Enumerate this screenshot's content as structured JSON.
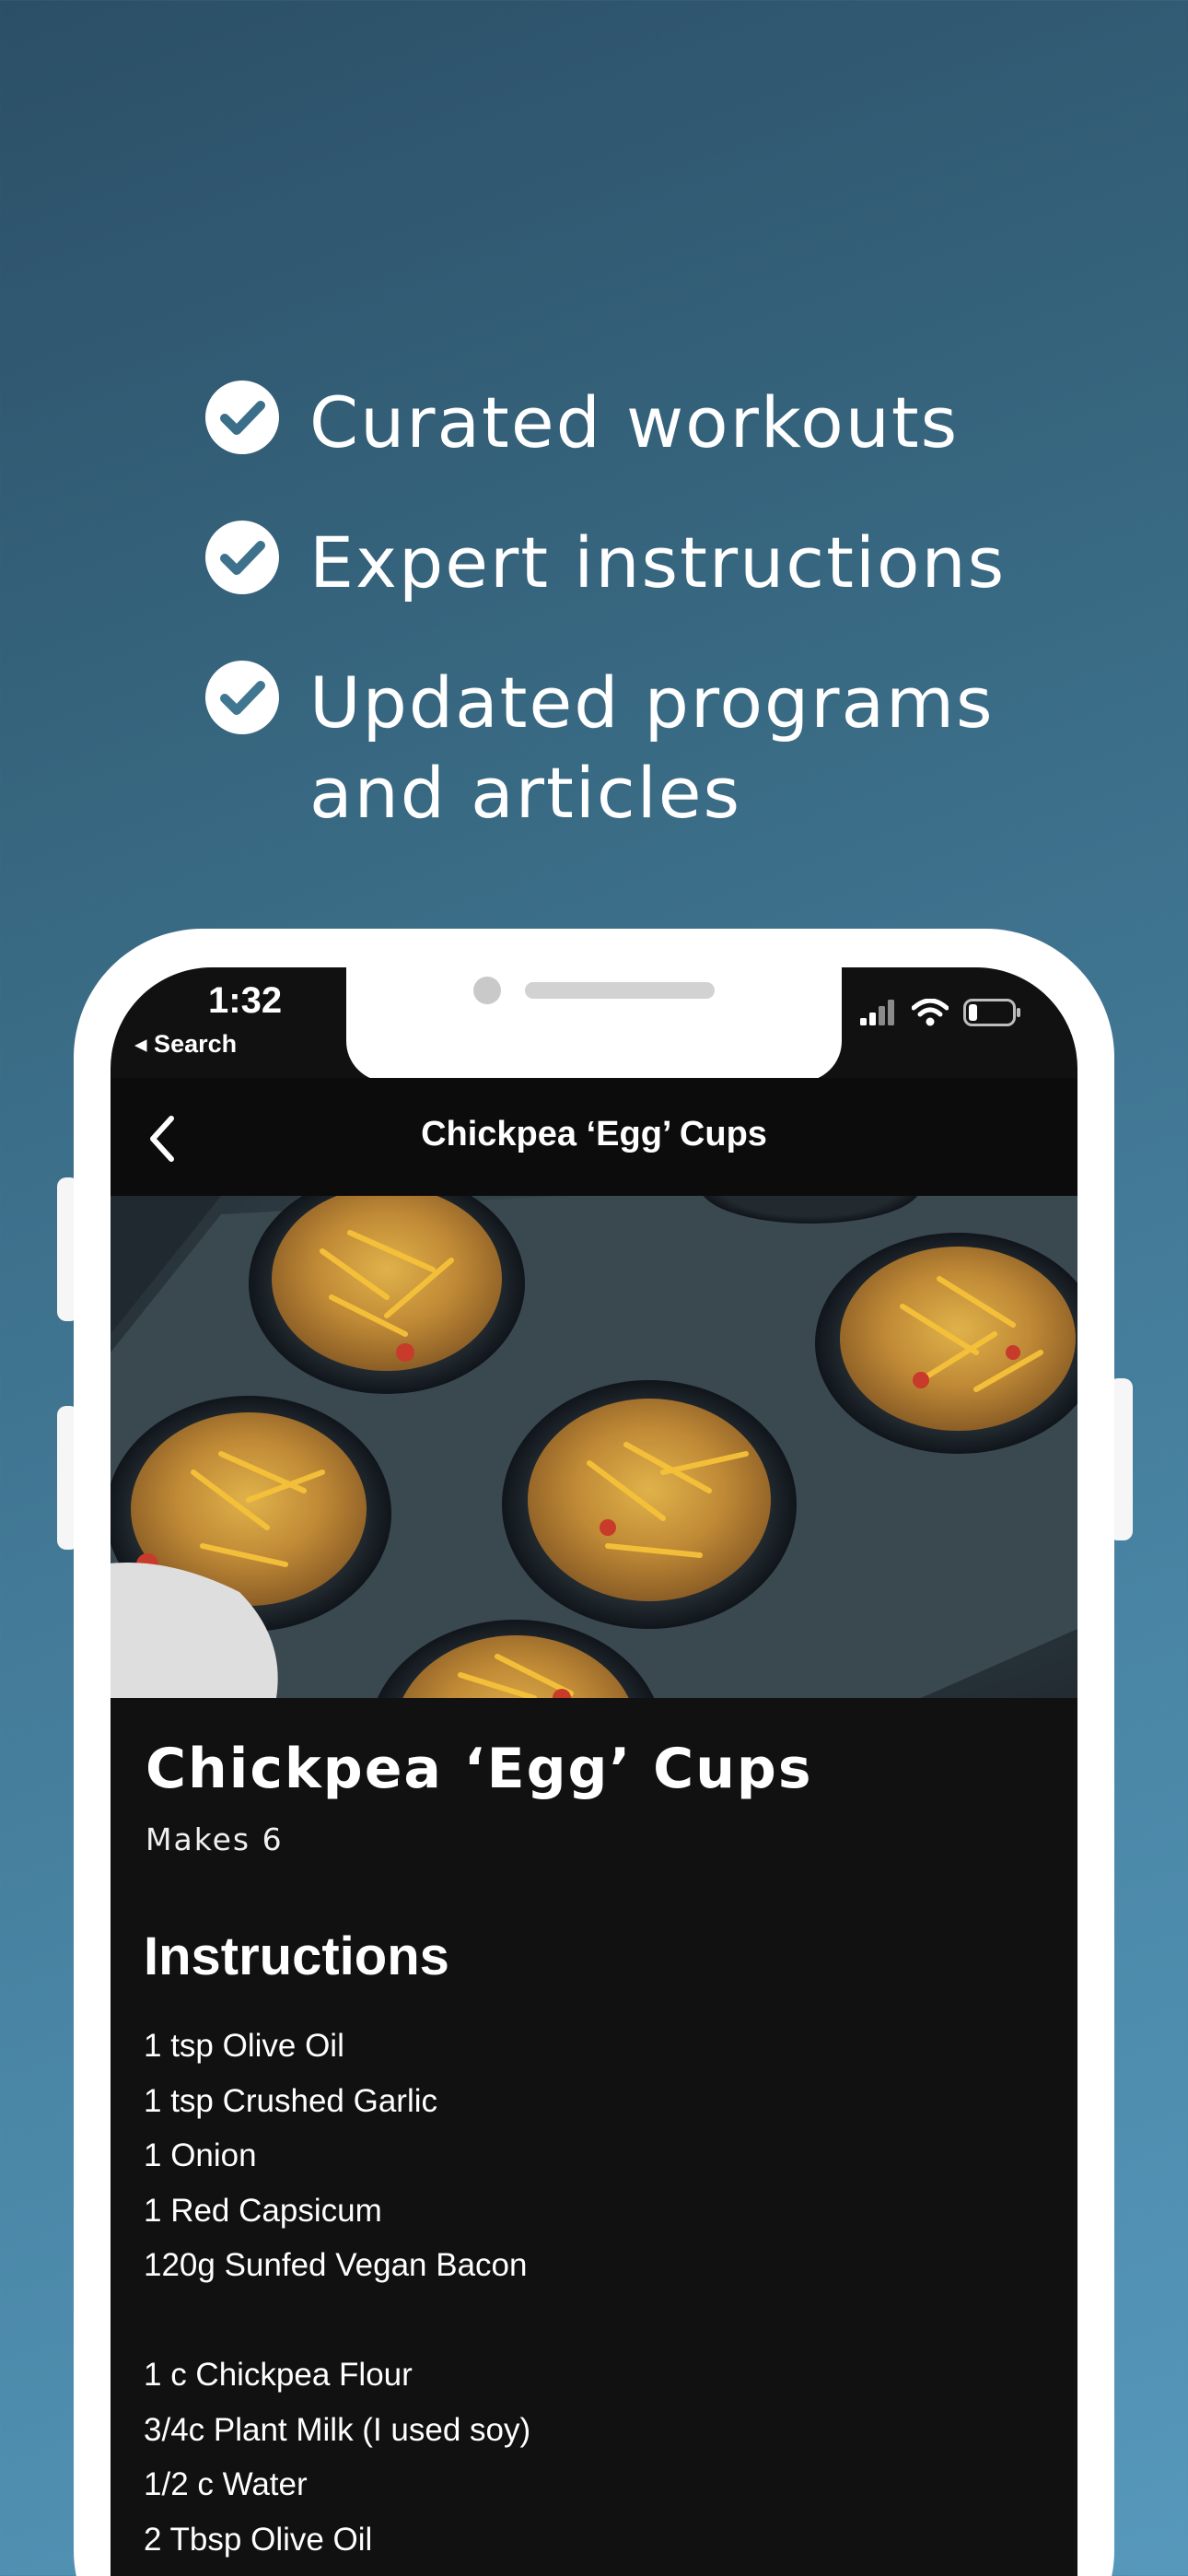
{
  "features": [
    {
      "text": "Curated workouts",
      "icon": "check-circle-icon"
    },
    {
      "text": "Expert instructions",
      "icon": "check-circle-icon"
    },
    {
      "text": "Updated programs and articles",
      "icon": "check-circle-icon"
    }
  ],
  "status_bar": {
    "time": "1:32",
    "back_label": "◂ Search",
    "icons": [
      "signal-icon",
      "wifi-icon",
      "battery-icon"
    ]
  },
  "nav": {
    "title": "Chickpea ‘Egg’ Cups",
    "back_icon": "chevron-left-icon"
  },
  "recipe": {
    "title": "Chickpea ‘Egg’ Cups",
    "yield": "Makes 6",
    "instructions_heading": "Instructions",
    "ingredients_group1": [
      "1 tsp Olive Oil",
      "1 tsp Crushed Garlic",
      "1 Onion",
      "1 Red Capsicum",
      "120g Sunfed Vegan Bacon"
    ],
    "ingredients_group2": [
      "1 c Chickpea Flour",
      "3/4c Plant Milk (I used soy)",
      "1/2 c Water",
      "2 Tbsp Olive Oil"
    ]
  },
  "colors": {
    "bg_top": "#2b4f66",
    "bg_bottom": "#5698bb",
    "screen_bg": "#111111",
    "text": "#ffffff"
  }
}
